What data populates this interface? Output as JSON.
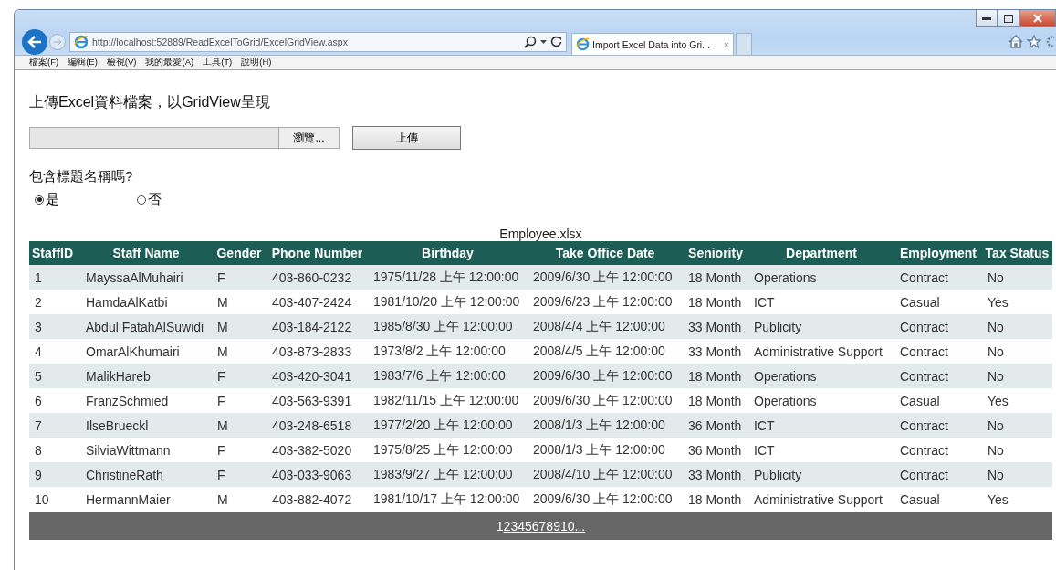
{
  "browser": {
    "url": "http://localhost:52889/ReadExcelToGrid/ExcelGridView.aspx",
    "tab_title": "Import Excel Data into Gri...",
    "tab_close": "×"
  },
  "menu": [
    "檔案(F)",
    "編輯(E)",
    "檢視(V)",
    "我的最愛(A)",
    "工具(T)",
    "說明(H)"
  ],
  "page": {
    "heading": "上傳Excel資料檔案，以GridView呈現",
    "browse_button": "瀏覽...",
    "upload_button": "上傳",
    "question": "包含標題名稱嗎?",
    "radios": [
      {
        "label": "是",
        "selected": true
      },
      {
        "label": "否",
        "selected": false
      }
    ]
  },
  "grid": {
    "caption": "Employee.xlsx",
    "columns": [
      "StaffID",
      "Staff Name",
      "Gender",
      "Phone Number",
      "Birthday",
      "Take Office Date",
      "Seniority",
      "Department",
      "Employment",
      "Tax Status"
    ],
    "rows": [
      [
        "1",
        "MayssaAlMuhairi",
        "F",
        "403-860-0232",
        "1975/11/28 上午 12:00:00",
        "2009/6/30 上午 12:00:00",
        "18 Month",
        "Operations",
        "Contract",
        "No"
      ],
      [
        "2",
        "HamdaAlKatbi",
        "M",
        "403-407-2424",
        "1981/10/20 上午 12:00:00",
        "2009/6/23 上午 12:00:00",
        "18 Month",
        "ICT",
        "Casual",
        "Yes"
      ],
      [
        "3",
        "Abdul FatahAlSuwidi",
        "M",
        "403-184-2122",
        "1985/8/30 上午 12:00:00",
        "2008/4/4 上午 12:00:00",
        "33 Month",
        "Publicity",
        "Contract",
        "No"
      ],
      [
        "4",
        "OmarAlKhumairi",
        "M",
        "403-873-2833",
        "1973/8/2 上午 12:00:00",
        "2008/4/5 上午 12:00:00",
        "33 Month",
        "Administrative Support",
        "Contract",
        "No"
      ],
      [
        "5",
        "MalikHareb",
        "F",
        "403-420-3041",
        "1983/7/6 上午 12:00:00",
        "2009/6/30 上午 12:00:00",
        "18 Month",
        "Operations",
        "Contract",
        "No"
      ],
      [
        "6",
        "FranzSchmied",
        "F",
        "403-563-9391",
        "1982/11/15 上午 12:00:00",
        "2009/6/30 上午 12:00:00",
        "18 Month",
        "Operations",
        "Casual",
        "Yes"
      ],
      [
        "7",
        "IlseBrueckl",
        "M",
        "403-248-6518",
        "1977/2/20 上午 12:00:00",
        "2008/1/3 上午 12:00:00",
        "36 Month",
        "ICT",
        "Contract",
        "No"
      ],
      [
        "8",
        "SilviaWittmann",
        "F",
        "403-382-5020",
        "1975/8/25 上午 12:00:00",
        "2008/1/3 上午 12:00:00",
        "36 Month",
        "ICT",
        "Contract",
        "No"
      ],
      [
        "9",
        "ChristineRath",
        "F",
        "403-033-9063",
        "1983/9/27 上午 12:00:00",
        "2008/4/10 上午 12:00:00",
        "33 Month",
        "Publicity",
        "Contract",
        "No"
      ],
      [
        "10",
        "HermannMaier",
        "M",
        "403-882-4072",
        "1981/10/17 上午 12:00:00",
        "2009/6/30 上午 12:00:00",
        "18 Month",
        "Administrative Support",
        "Casual",
        "Yes"
      ]
    ],
    "pager": [
      {
        "label": "1",
        "selected": true
      },
      {
        "label": "2",
        "selected": false
      },
      {
        "label": "3",
        "selected": false
      },
      {
        "label": "4",
        "selected": false
      },
      {
        "label": "5",
        "selected": false
      },
      {
        "label": "6",
        "selected": false
      },
      {
        "label": "7",
        "selected": false
      },
      {
        "label": "8",
        "selected": false
      },
      {
        "label": "9",
        "selected": false
      },
      {
        "label": "10",
        "selected": false
      },
      {
        "label": "...",
        "selected": false
      }
    ]
  }
}
